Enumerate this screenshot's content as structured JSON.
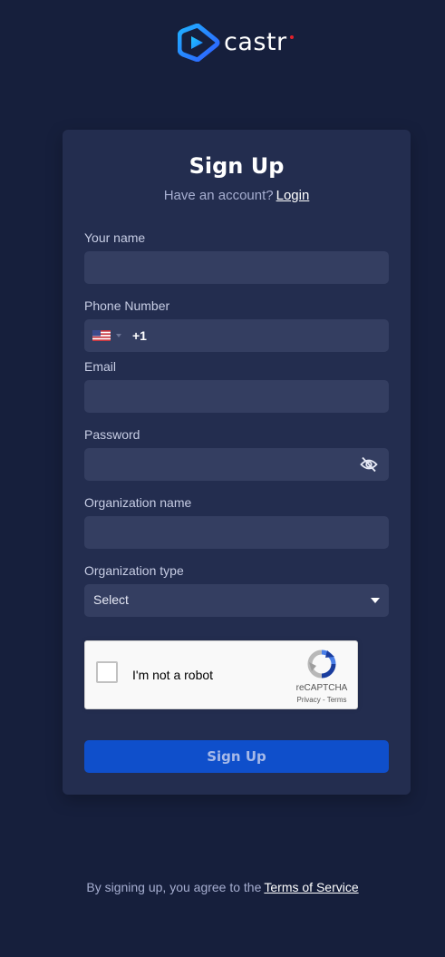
{
  "brand": {
    "name": "castr",
    "logo_icon": "castr-play-logo-icon",
    "accent_dot_color": "#e3202b"
  },
  "form": {
    "title": "Sign Up",
    "subtitle": "Have an account?",
    "login_link": "Login",
    "fields": {
      "name": {
        "label": "Your name",
        "value": ""
      },
      "phone": {
        "label": "Phone Number",
        "country_flag": "us-flag-icon",
        "country_code": "+1",
        "value": ""
      },
      "email": {
        "label": "Email",
        "value": ""
      },
      "password": {
        "label": "Password",
        "value": "",
        "toggle_icon": "eye-off-icon"
      },
      "organization_name": {
        "label": "Organization name",
        "value": ""
      },
      "organization_type": {
        "label": "Organization type",
        "selected": "Select"
      }
    },
    "recaptcha": {
      "label": "I'm not a robot",
      "brand": "reCAPTCHA",
      "links": "Privacy - Terms"
    },
    "submit_label": "Sign Up"
  },
  "footer": {
    "text": "By signing up, you agree to the",
    "terms_link": "Terms of Service"
  },
  "colors": {
    "background": "#161f3c",
    "card": "#232d4f",
    "input": "#343e61",
    "primary_button": "#0f4fcb"
  }
}
